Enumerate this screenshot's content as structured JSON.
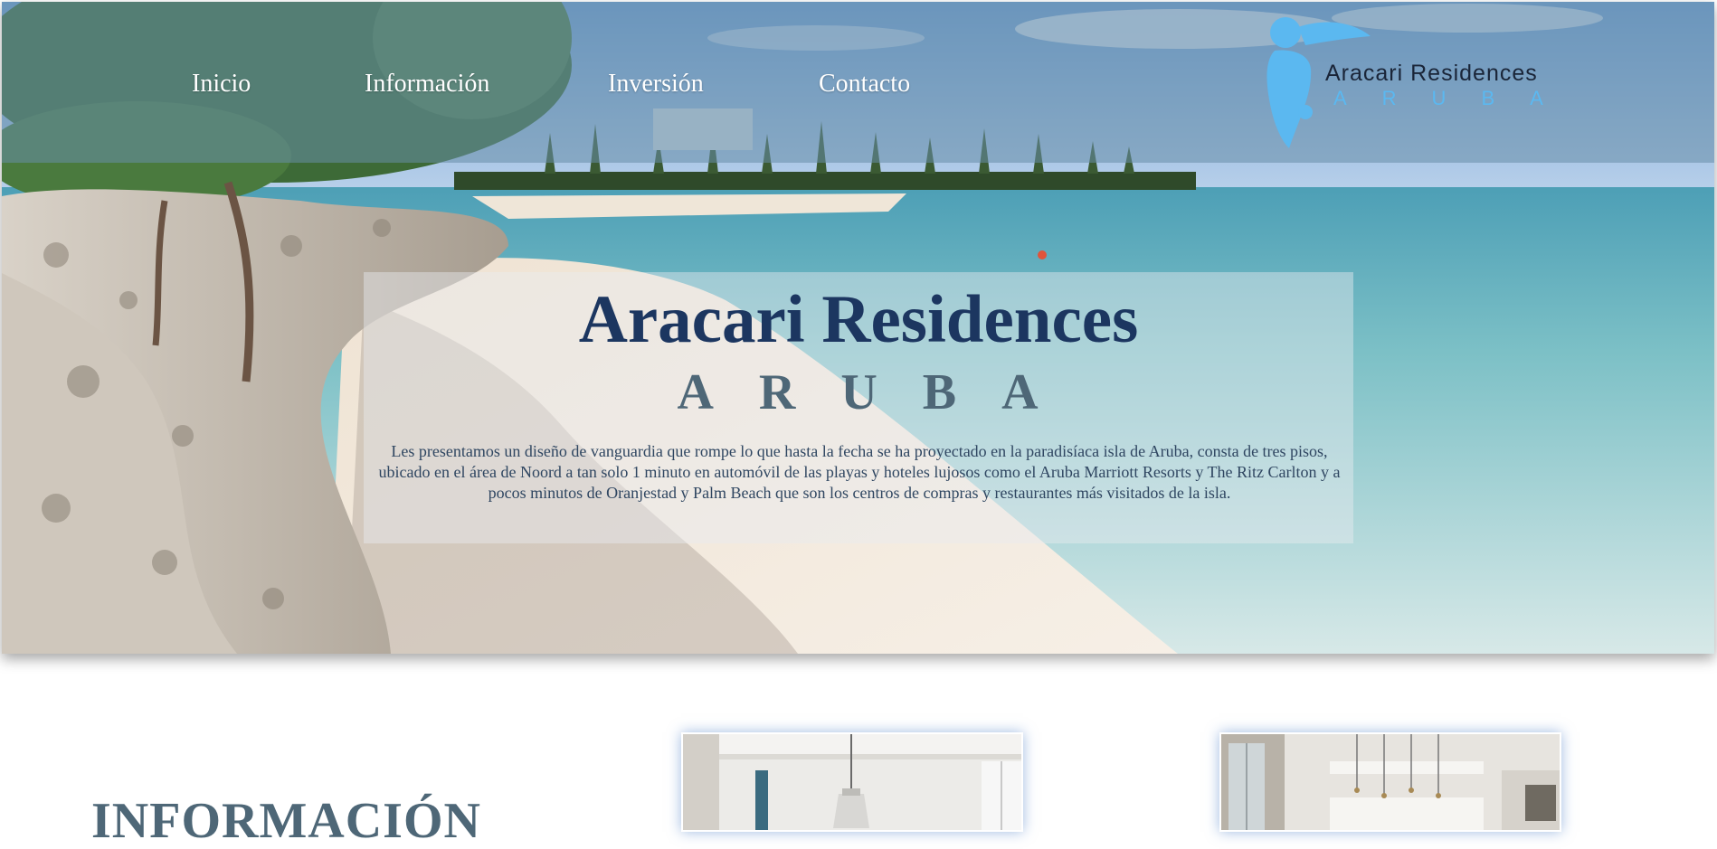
{
  "nav": {
    "items": [
      {
        "label": "Inicio"
      },
      {
        "label": "Información"
      },
      {
        "label": "Inversión"
      },
      {
        "label": "Contacto"
      }
    ]
  },
  "logo": {
    "name": "Aracari Residences",
    "sub": "ARUBA"
  },
  "hero": {
    "title": "Aracari Residences",
    "subtitle": "ARUBA",
    "description": "Les presentamos un diseño de vanguardia que rompe lo que hasta la fecha se ha proyectado en la paradisíaca isla de Aruba, consta de tres pisos, ubicado en el área de Noord a tan solo 1 minuto en automóvil de las playas y hoteles lujosos como el Aruba Marriott Resorts y The Ritz Carlton y a pocos minutos de Oranjestad y Palm Beach que son los centros de compras y restaurantes más visitados de la isla."
  },
  "info": {
    "title": "INFORMACIÓN"
  },
  "colors": {
    "nav_text": "#ffffff",
    "hero_title": "#1c3660",
    "hero_subtitle": "#4e6777",
    "logo_accent": "#5bb8f0",
    "section_title": "#4e6777"
  },
  "icons": {
    "logo_mark": "toucan-figure-icon"
  }
}
